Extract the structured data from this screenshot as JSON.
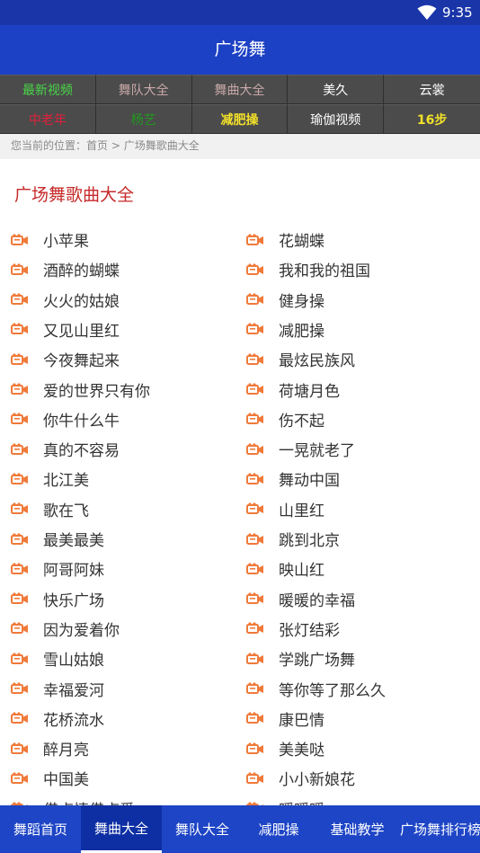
{
  "status_bar": {
    "time": "9:35",
    "icon": "wifi-icon"
  },
  "header": {
    "title": "广场舞"
  },
  "nav": {
    "items": [
      {
        "label": "最新视频",
        "color": "#48d648",
        "bold": false
      },
      {
        "label": "舞队大全",
        "color": "#c9a9a9",
        "bold": false
      },
      {
        "label": "舞曲大全",
        "color": "#c9a9a9",
        "bold": false
      },
      {
        "label": "美久",
        "color": "#ffffff",
        "bold": false
      },
      {
        "label": "云裳",
        "color": "#ffffff",
        "bold": false
      },
      {
        "label": "中老年",
        "color": "#e0203c",
        "bold": false
      },
      {
        "label": "杨艺",
        "color": "#1f9a1f",
        "bold": false
      },
      {
        "label": "减肥操",
        "color": "#f2e02a",
        "bold": true
      },
      {
        "label": "瑜伽视频",
        "color": "#ffffff",
        "bold": false
      },
      {
        "label": "16步",
        "color": "#f2e02a",
        "bold": true
      }
    ]
  },
  "breadcrumb": {
    "prefix": "您当前的位置：",
    "home": "首页",
    "separator": " > ",
    "current": "广场舞歌曲大全"
  },
  "section": {
    "title": "广场舞歌曲大全"
  },
  "songs": {
    "icon": "video-camera-icon",
    "icon_color": "#f07a3a",
    "left": [
      "小苹果",
      "酒醉的蝴蝶",
      "火火的姑娘",
      "又见山里红",
      "今夜舞起来",
      "爱的世界只有你",
      "你牛什么牛",
      "真的不容易",
      "北江美",
      "歌在飞",
      "最美最美",
      "阿哥阿妹",
      "快乐广场",
      "因为爱着你",
      "雪山姑娘",
      "幸福爱河",
      "花桥流水",
      "醉月亮",
      "中国美",
      "借卢情借卢爱"
    ],
    "right": [
      "花蝴蝶",
      "我和我的祖国",
      "健身操",
      "减肥操",
      "最炫民族风",
      "荷塘月色",
      "伤不起",
      "一晃就老了",
      "舞动中国",
      "山里红",
      "跳到北京",
      "映山红",
      "暖暖的幸福",
      "张灯结彩",
      "学跳广场舞",
      "等你等了那么久",
      "康巴情",
      "美美哒",
      "小小新娘花",
      "暖暖暖"
    ]
  },
  "bottom_nav": {
    "active_index": 1,
    "tabs": [
      "舞蹈首页",
      "舞曲大全",
      "舞队大全",
      "减肥操",
      "基础教学",
      "广场舞排行榜"
    ]
  }
}
